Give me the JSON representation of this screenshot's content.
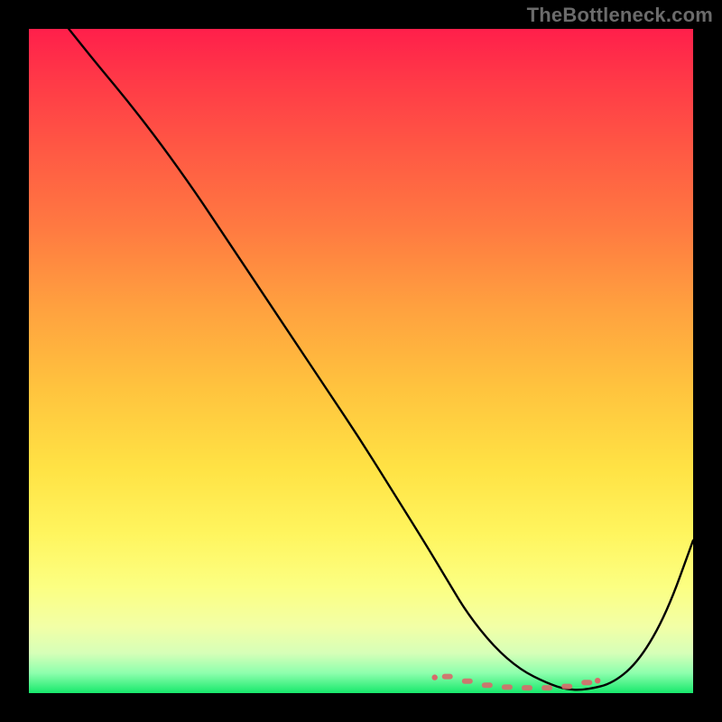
{
  "watermark": "TheBottleneck.com",
  "chart_data": {
    "type": "line",
    "title": "",
    "xlabel": "",
    "ylabel": "",
    "xlim": [
      0,
      100
    ],
    "ylim": [
      0,
      100
    ],
    "grid": false,
    "legend": false,
    "annotations": [],
    "series": [
      {
        "name": "curve",
        "color": "#000000",
        "x": [
          6,
          10,
          15,
          20,
          25,
          30,
          35,
          40,
          45,
          50,
          55,
          60,
          63,
          66,
          70,
          74,
          78,
          81,
          84,
          88,
          92,
          96,
          100
        ],
        "y": [
          100,
          95,
          89,
          82.5,
          75.5,
          68,
          60.5,
          53,
          45.5,
          38,
          30,
          22,
          17,
          12,
          7,
          3.5,
          1.5,
          0.5,
          0.5,
          1.5,
          5,
          12,
          23
        ]
      },
      {
        "name": "flat-zone-markers",
        "color": "#d86a6a",
        "style": "dotted",
        "x": [
          63,
          66,
          69,
          72,
          75,
          78,
          81,
          84
        ],
        "y": [
          2.5,
          1.8,
          1.2,
          0.9,
          0.8,
          0.8,
          1.0,
          1.6
        ]
      }
    ]
  }
}
